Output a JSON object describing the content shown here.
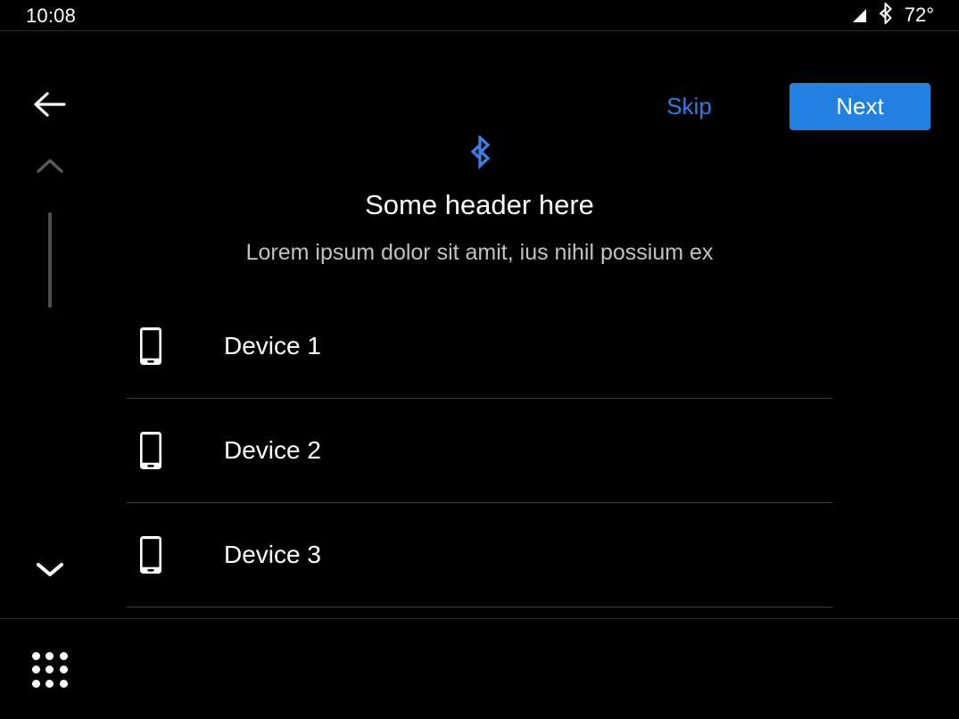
{
  "status_bar": {
    "clock": "10:08",
    "temperature": "72°",
    "signal_icon": "signal-bar-icon",
    "bluetooth_icon": "bluetooth-icon"
  },
  "action_bar": {
    "back_icon": "arrow-left-icon",
    "skip_label": "Skip",
    "next_label": "Next",
    "next_bg_color": "#2081e2",
    "skip_text_color": "#2b7de9"
  },
  "scroll_rail": {
    "up_icon": "chevron-up-icon",
    "down_icon": "chevron-down-icon",
    "thumb_color": "#4c4c4c"
  },
  "content": {
    "hero_icon": "bluetooth-icon",
    "hero_icon_color": "#3b7ee6",
    "title": "Some header here",
    "subtitle": "Lorem ipsum dolor sit amit, ius nihil possium ex",
    "devices": [
      {
        "icon": "smartphone-icon",
        "label": "Device 1"
      },
      {
        "icon": "smartphone-icon",
        "label": "Device 2"
      },
      {
        "icon": "smartphone-icon",
        "label": "Device 3"
      }
    ]
  },
  "bottom_bar": {
    "app_grid_icon": "apps-grid-icon"
  }
}
